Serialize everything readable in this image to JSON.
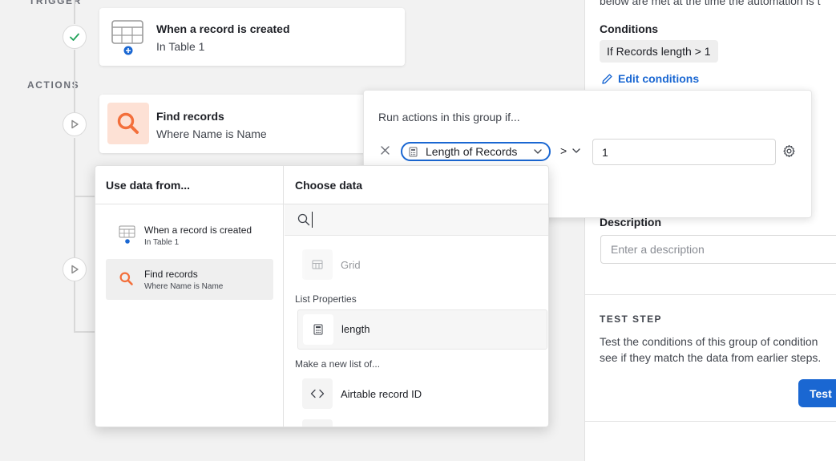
{
  "flow": {
    "trigger_label": "TRIGGER",
    "actions_label": "ACTIONS",
    "trigger_card": {
      "title": "When a record is created",
      "subtitle": "In Table 1"
    },
    "find_card": {
      "title": "Find records",
      "subtitle": "Where Name is Name"
    }
  },
  "right_panel": {
    "intro_text": "below are met at the time the automation is t",
    "conditions_heading": "Conditions",
    "condition_chip": "If Records length > 1",
    "edit_conditions": "Edit conditions",
    "description_heading": "Description",
    "description_placeholder": "Enter a description",
    "test_step_heading": "TEST STEP",
    "test_step_line1": "Test the conditions of this group of condition",
    "test_step_line2": "see if they match the data from earlier steps.",
    "test_button": "Test"
  },
  "conditions_popover": {
    "title": "Run actions in this group if...",
    "field_pill": "Length of Records",
    "operator": ">",
    "value": "1"
  },
  "data_picker": {
    "left_header": "Use data from...",
    "right_header": "Choose data",
    "sources": [
      {
        "title": "When a record is created",
        "subtitle": "In Table 1"
      },
      {
        "title": "Find records",
        "subtitle": "Where Name is Name"
      }
    ],
    "search_value": "",
    "grid_label": "Grid",
    "list_properties_label": "List Properties",
    "length_label": "length",
    "make_list_label": "Make a new list of...",
    "airtable_id_label": "Airtable record ID"
  },
  "colors": {
    "accent_blue": "#1a67d2",
    "find_orange": "#f36f3b",
    "find_tile_bg": "#fde1d5",
    "success_green": "#21a35a"
  },
  "icons": {
    "check": "check-icon",
    "play": "play-icon",
    "table": "table-icon",
    "search": "search-icon",
    "pencil": "pencil-icon",
    "close": "close-icon",
    "chevron": "chevron-down-icon",
    "gear": "gear-icon",
    "calculator": "calculator-icon",
    "code": "code-icon"
  }
}
